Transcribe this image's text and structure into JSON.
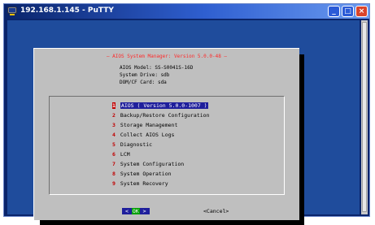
{
  "window": {
    "title": "192.168.1.145 - PuTTY",
    "buttons": {
      "minimize": "_",
      "maximize": "□",
      "close": "×"
    }
  },
  "dialog": {
    "title": "— AIOS System Manager: Version 5.0.0-48 —",
    "info": [
      "AIOS Model: SS-S0041S-16D",
      "System Drive: sdb",
      "DOM/CF Card: sda"
    ],
    "menu": [
      {
        "num": "1",
        "label": "AIOS ( Version 5.0.0-1007 )",
        "selected": true
      },
      {
        "num": "2",
        "label": "Backup/Restore Configuration",
        "selected": false
      },
      {
        "num": "3",
        "label": "Storage Management",
        "selected": false
      },
      {
        "num": "4",
        "label": "Collect AIOS Logs",
        "selected": false
      },
      {
        "num": "5",
        "label": "Diagnostic",
        "selected": false
      },
      {
        "num": "6",
        "label": "LCM",
        "selected": false
      },
      {
        "num": "7",
        "label": "System Configuration",
        "selected": false
      },
      {
        "num": "8",
        "label": "System Operation",
        "selected": false
      },
      {
        "num": "9",
        "label": "System Recovery",
        "selected": false
      }
    ],
    "ok_left": "<",
    "ok_label": "OK",
    "ok_right": ">",
    "cancel_label": "<Cancel>"
  },
  "colors": {
    "terminal_background": "#1f4c9c",
    "dialog_background": "#bfbfbf",
    "selection": "#1f1f9c",
    "menu_number": "#c00000",
    "title_text": "#ff2a2a"
  }
}
